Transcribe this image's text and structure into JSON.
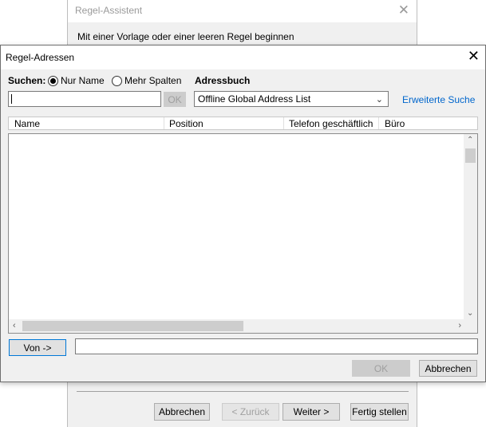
{
  "background_window": {
    "title": "Regel-Assistent",
    "subtitle": "Mit einer Vorlage oder einer leeren Regel beginnen",
    "buttons": {
      "cancel": "Abbrechen",
      "back": "< Zurück",
      "next": "Weiter >",
      "finish": "Fertig stellen"
    }
  },
  "dialog": {
    "title": "Regel-Adressen",
    "search": {
      "label": "Suchen:",
      "option_name_only": "Nur Name",
      "option_more_columns": "Mehr Spalten",
      "selected": "Nur Name",
      "value": "",
      "ok_label": "OK"
    },
    "address_book": {
      "label": "Adressbuch",
      "selected": "Offline Global Address List",
      "advanced_link": "Erweiterte Suche"
    },
    "columns": [
      "Name",
      "Position",
      "Telefon geschäftlich",
      "Büro"
    ],
    "rows": [],
    "from_button": "Von ->",
    "from_value": "",
    "ok_label": "OK",
    "cancel_label": "Abbrechen"
  },
  "icons": {
    "close": "close-icon",
    "dropdown": "chevron-down-icon",
    "scroll_up": "chevron-up-icon",
    "scroll_down": "chevron-down-icon",
    "scroll_left": "chevron-left-icon",
    "scroll_right": "chevron-right-icon"
  },
  "colors": {
    "link": "#0066cc",
    "primary_border": "#0078d7",
    "dialog_bg": "#f0f0f0"
  }
}
